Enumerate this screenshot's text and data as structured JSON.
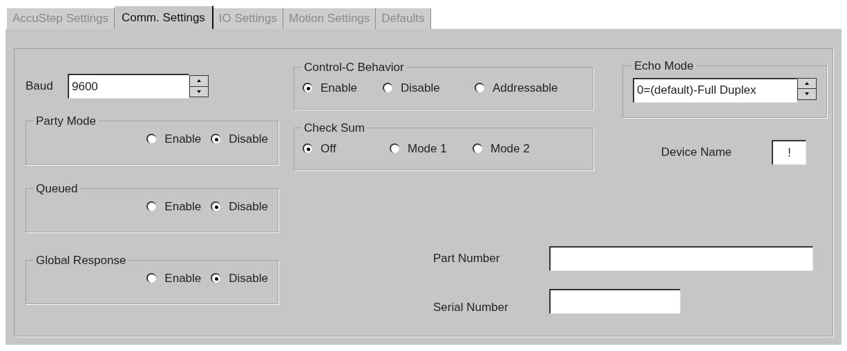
{
  "tabs": [
    {
      "label": "AccuStep Settings",
      "selected": false
    },
    {
      "label": "Comm. Settings",
      "selected": true
    },
    {
      "label": "IO Settings",
      "selected": false
    },
    {
      "label": "Motion Settings",
      "selected": false
    },
    {
      "label": "Defaults",
      "selected": false
    }
  ],
  "baud": {
    "label": "Baud",
    "value": "9600"
  },
  "left_groups": [
    {
      "title": "Party Mode",
      "options": [
        {
          "label": "Enable",
          "selected": false
        },
        {
          "label": "Disable",
          "selected": true
        }
      ]
    },
    {
      "title": "Queued",
      "options": [
        {
          "label": "Enable",
          "selected": false
        },
        {
          "label": "Disable",
          "selected": true
        }
      ]
    },
    {
      "title": "Global Response",
      "options": [
        {
          "label": "Enable",
          "selected": false
        },
        {
          "label": "Disable",
          "selected": true
        }
      ]
    }
  ],
  "control_c": {
    "title": "Control-C Behavior",
    "options": [
      {
        "label": "Enable",
        "selected": true
      },
      {
        "label": "Disable",
        "selected": false
      },
      {
        "label": "Addressable",
        "selected": false
      }
    ]
  },
  "check_sum": {
    "title": "Check Sum",
    "options": [
      {
        "label": "Off",
        "selected": true
      },
      {
        "label": "Mode 1",
        "selected": false
      },
      {
        "label": "Mode 2",
        "selected": false
      }
    ]
  },
  "echo_mode": {
    "title": "Echo Mode",
    "value": "0=(default)-Full Duplex"
  },
  "device_name": {
    "label": "Device Name",
    "value": "!"
  },
  "part_number": {
    "label": "Part Number"
  },
  "serial_number": {
    "label": "Serial Number"
  }
}
